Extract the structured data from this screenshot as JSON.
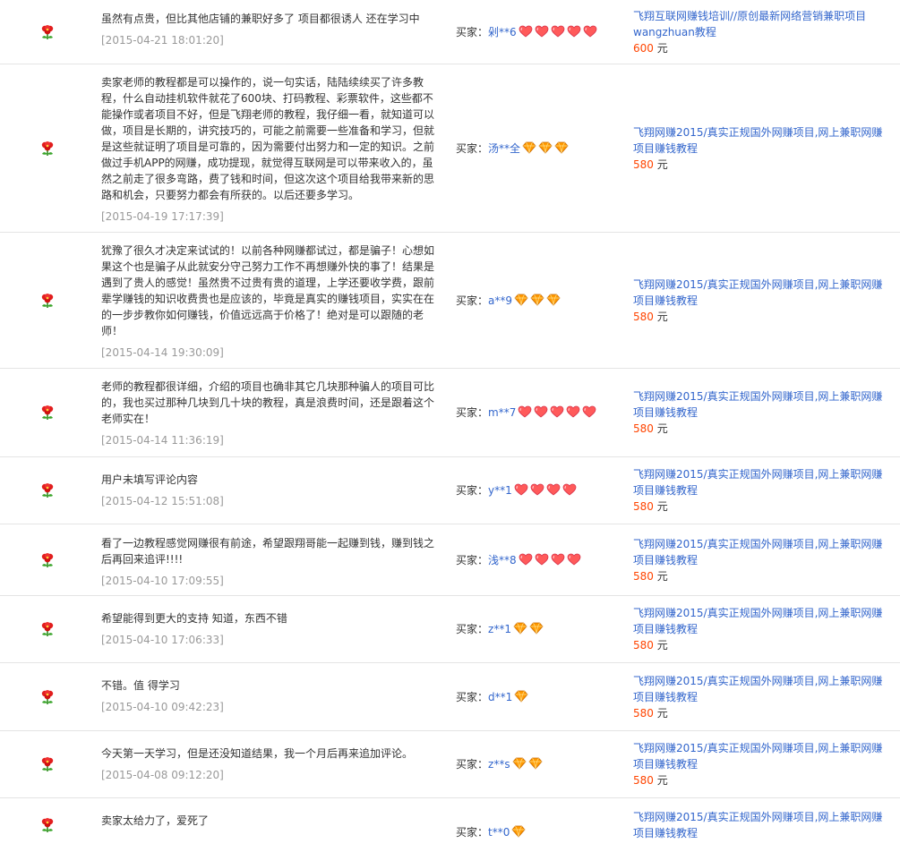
{
  "labels": {
    "buyer_prefix": "买家：",
    "currency": "元"
  },
  "colors": {
    "link": "#3366cc",
    "price": "#ff4400",
    "date": "#999999",
    "heart": "#ff5a5a",
    "diamond": "#ff9900"
  },
  "icons": {
    "flower": "flower-icon",
    "heart": "heart-icon",
    "diamond": "diamond-icon"
  },
  "reviews": [
    {
      "text": "虽然有点贵，但比其他店铺的兼职好多了 项目都很诱人 还在学习中",
      "date": "[2015-04-21 18:01:20]",
      "buyer": "剁**6",
      "level_icon": "heart",
      "level_count": 5,
      "item_title": "飞翔互联网赚钱培训//原创最新网络营销兼职项目wangzhuan教程",
      "price": "600"
    },
    {
      "text": "卖家老师的教程都是可以操作的，说一句实话，陆陆续续买了许多教程，什么自动挂机软件就花了600块、打码教程、彩票软件，这些都不能操作或者项目不好，但是飞翔老师的教程，我仔细一看，就知道可以做，项目是长期的，讲究技巧的，可能之前需要一些准备和学习，但就是这些就证明了项目是可靠的，因为需要付出努力和一定的知识。之前做过手机APP的网赚，成功提现，就觉得互联网是可以带来收入的，虽然之前走了很多弯路，费了钱和时间，但这次这个项目给我带来新的思路和机会，只要努力都会有所获的。以后还要多学习。",
      "date": "[2015-04-19 17:17:39]",
      "buyer": "汤**全",
      "level_icon": "diamond",
      "level_count": 3,
      "item_title": "飞翔网赚2015/真实正规国外网赚项目,网上兼职网赚项目赚钱教程",
      "price": "580"
    },
    {
      "text": "犹豫了很久才决定来试试的！以前各种网赚都试过，都是骗子！心想如果这个也是骗子从此就安分守己努力工作不再想赚外快的事了！结果是遇到了贵人的感觉！虽然贵不过贵有贵的道理，上学还要收学费，跟前辈学赚钱的知识收费贵也是应该的，毕竟是真实的赚钱项目，实实在在的一步步教你如何赚钱，价值远远高于价格了！绝对是可以跟随的老师！",
      "date": "[2015-04-14 19:30:09]",
      "buyer": "a**9",
      "level_icon": "diamond",
      "level_count": 3,
      "item_title": "飞翔网赚2015/真实正规国外网赚项目,网上兼职网赚项目赚钱教程",
      "price": "580"
    },
    {
      "text": "老师的教程都很详细，介绍的项目也确非其它几块那种骗人的项目可比的，我也买过那种几块到几十块的教程，真是浪费时间，还是跟着这个老师实在！",
      "date": "[2015-04-14 11:36:19]",
      "buyer": "m**7",
      "level_icon": "heart",
      "level_count": 5,
      "item_title": "飞翔网赚2015/真实正规国外网赚项目,网上兼职网赚项目赚钱教程",
      "price": "580"
    },
    {
      "text": "用户未填写评论内容",
      "date": "[2015-04-12 15:51:08]",
      "buyer": "y**1",
      "level_icon": "heart",
      "level_count": 4,
      "item_title": "飞翔网赚2015/真实正规国外网赚项目,网上兼职网赚项目赚钱教程",
      "price": "580"
    },
    {
      "text": "看了一边教程感觉网赚很有前途，希望跟翔哥能一起赚到钱，赚到钱之后再回来追评!!!!",
      "date": "[2015-04-10 17:09:55]",
      "buyer": "浅**8",
      "level_icon": "heart",
      "level_count": 4,
      "item_title": "飞翔网赚2015/真实正规国外网赚项目,网上兼职网赚项目赚钱教程",
      "price": "580"
    },
    {
      "text": "希望能得到更大的支持 知道，东西不错",
      "date": "[2015-04-10 17:06:33]",
      "buyer": "z**1",
      "level_icon": "diamond",
      "level_count": 2,
      "item_title": "飞翔网赚2015/真实正规国外网赚项目,网上兼职网赚项目赚钱教程",
      "price": "580"
    },
    {
      "text": "不错。值 得学习",
      "date": "[2015-04-10 09:42:23]",
      "buyer": "d**1",
      "level_icon": "diamond",
      "level_count": 1,
      "item_title": "飞翔网赚2015/真实正规国外网赚项目,网上兼职网赚项目赚钱教程",
      "price": "580"
    },
    {
      "text": "今天第一天学习，但是还没知道结果，我一个月后再来追加评论。",
      "date": "[2015-04-08 09:12:20]",
      "buyer": "z**s",
      "level_icon": "diamond",
      "level_count": 2,
      "item_title": "飞翔网赚2015/真实正规国外网赚项目,网上兼职网赚项目赚钱教程",
      "price": "580"
    },
    {
      "text": "卖家太给力了，爱死了",
      "date": "",
      "buyer": "t**0",
      "level_icon": "diamond",
      "level_count": 1,
      "item_title": "飞翔网赚2015/真实正规国外网赚项目,网上兼职网赚项目赚钱教程",
      "price": ""
    }
  ]
}
